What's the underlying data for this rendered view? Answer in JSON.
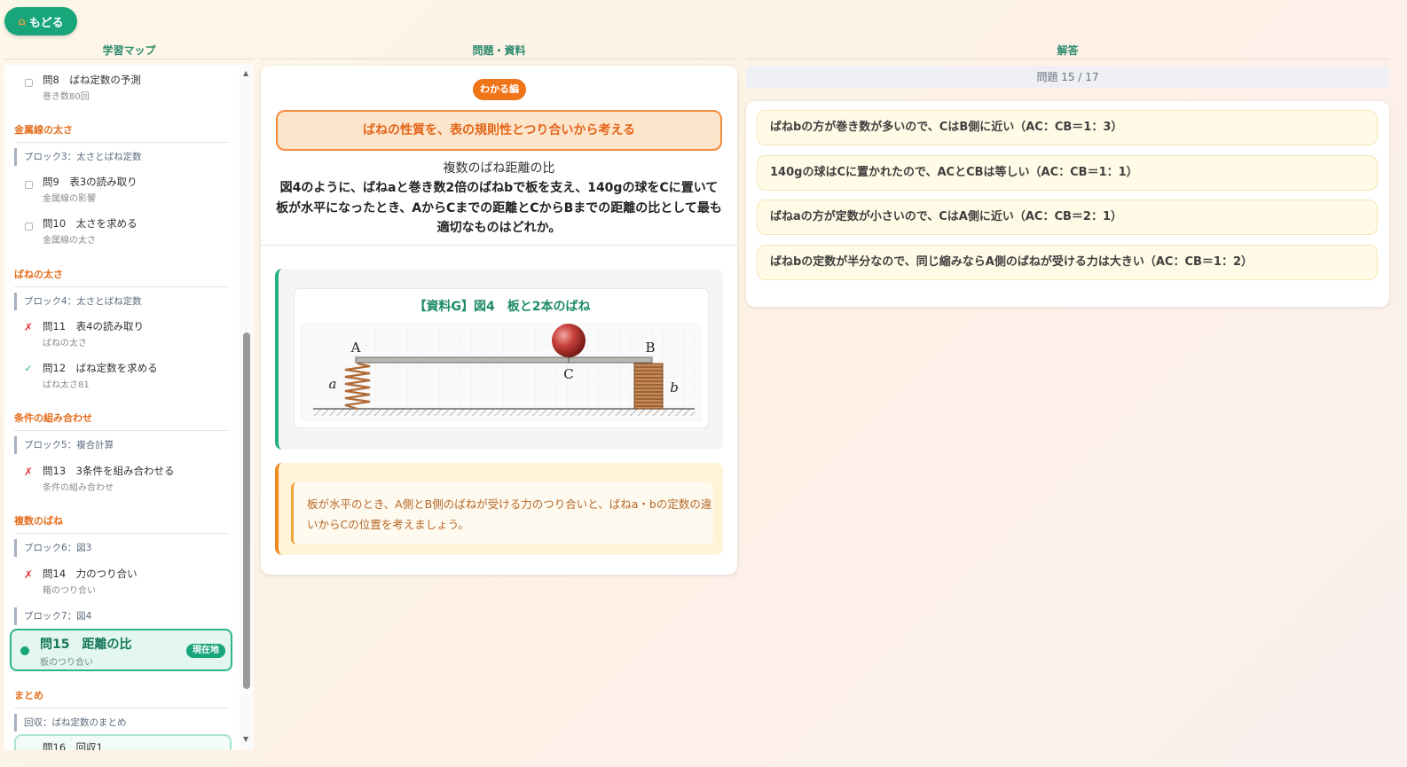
{
  "back_button": {
    "icon": "home-icon",
    "label": "もどる"
  },
  "columns": {
    "map": "学習マップ",
    "problem": "問題・資料",
    "answer": "解答"
  },
  "sidebar": {
    "top_item": {
      "title": "問8　ばね定数の予測",
      "sub": "巻き数80回",
      "status": "unchecked"
    },
    "categories": [
      {
        "label": "金属線の太さ"
      },
      {
        "label": "ばねの太さ"
      },
      {
        "label": "条件の組み合わせ"
      },
      {
        "label": "複数のばね"
      },
      {
        "label": "まとめ"
      }
    ],
    "blocks": [
      "ブロック3：太さとばね定数",
      "ブロック4：太さとばね定数",
      "ブロック5：複合計算",
      "ブロック6：図3",
      "ブロック7：図4",
      "回収：ばね定数のまとめ"
    ],
    "items": [
      {
        "title": "問9　表3の読み取り",
        "sub": "金属線の影響",
        "status": "unchecked"
      },
      {
        "title": "問10　太さを求める",
        "sub": "金属線の太さ",
        "status": "unchecked"
      },
      {
        "title": "問11　表4の読み取り",
        "sub": "ばねの太さ",
        "status": "wrong"
      },
      {
        "title": "問12　ばね定数を求める",
        "sub": "ばね太さ81",
        "status": "correct"
      },
      {
        "title": "問13　3条件を組み合わせる",
        "sub": "条件の組み合わせ",
        "status": "wrong"
      },
      {
        "title": "問14　力のつり合い",
        "sub": "箱のつり合い",
        "status": "wrong"
      }
    ],
    "current": {
      "title": "問15　距離の比",
      "sub": "板のつり合い",
      "badge": "現在地"
    },
    "next_item": {
      "title": "問16　回収1"
    }
  },
  "problem": {
    "level_pill": "わかる編",
    "topic": "ばねの性質を、表の規則性とつり合いから考える",
    "subtitle": "複数のばね距離の比",
    "question": "図4のように、ばねaと巻き数2倍のばねbで板を支え、140gの球をCに置いて板が水平になったとき、AからCまでの距離とCからBまでの距離の比として最も適切なものはどれか。",
    "resource_title": "【資料G】図4　板と2本のばね",
    "diagram_labels": {
      "A": "A",
      "B": "B",
      "C": "C",
      "a": "a",
      "b": "b"
    },
    "hint": "板が水平のとき、A側とB側のばねが受ける力のつり合いと、ばねa・bの定数の違いからCの位置を考えましょう。"
  },
  "answer": {
    "progress": "問題 15 / 17",
    "choices": [
      "ばねbの方が巻き数が多いので、CはB側に近い（AC：CB＝1：3）",
      "140gの球はCに置かれたので、ACとCBは等しい（AC：CB＝1：1）",
      "ばねaの方が定数が小さいので、CはA側に近い（AC：CB＝2：1）",
      "ばねbの定数が半分なので、同じ縮みならA側のばねが受ける力は大きい（AC：CB＝1：2）"
    ]
  },
  "colors": {
    "accent_green": "#18a57a",
    "accent_orange": "#f07418",
    "wrong_red": "#e0393e"
  }
}
